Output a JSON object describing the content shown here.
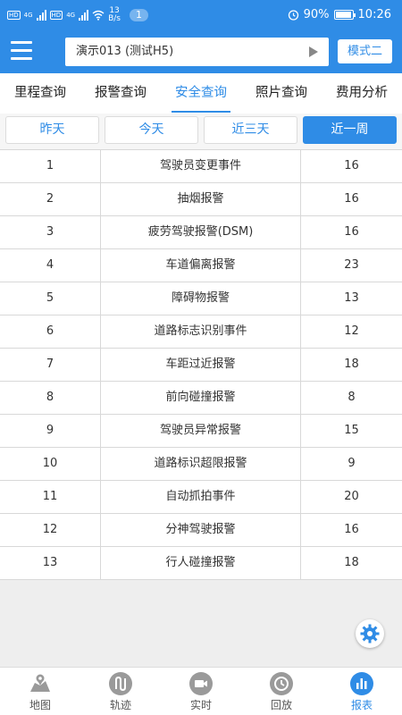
{
  "status_bar": {
    "net_speed": "13",
    "net_unit": "B/s",
    "notification_count": "1",
    "battery": "90%",
    "time": "10:26",
    "signal1": "4G",
    "signal2": "4G"
  },
  "header": {
    "vehicle": "演示013 (测试H5)",
    "mode_button": "模式二"
  },
  "tabs": [
    {
      "label": "里程查询"
    },
    {
      "label": "报警查询"
    },
    {
      "label": "安全查询"
    },
    {
      "label": "照片查询"
    },
    {
      "label": "费用分析"
    }
  ],
  "filters": [
    {
      "label": "昨天"
    },
    {
      "label": "今天"
    },
    {
      "label": "近三天"
    },
    {
      "label": "近一周"
    }
  ],
  "rows": [
    {
      "no": "1",
      "name": "驾驶员变更事件",
      "count": "16"
    },
    {
      "no": "2",
      "name": "抽烟报警",
      "count": "16"
    },
    {
      "no": "3",
      "name": "疲劳驾驶报警(DSM)",
      "count": "16"
    },
    {
      "no": "4",
      "name": "车道偏离报警",
      "count": "23"
    },
    {
      "no": "5",
      "name": "障碍物报警",
      "count": "13"
    },
    {
      "no": "6",
      "name": "道路标志识别事件",
      "count": "12"
    },
    {
      "no": "7",
      "name": "车距过近报警",
      "count": "18"
    },
    {
      "no": "8",
      "name": "前向碰撞报警",
      "count": "8"
    },
    {
      "no": "9",
      "name": "驾驶员异常报警",
      "count": "15"
    },
    {
      "no": "10",
      "name": "道路标识超限报警",
      "count": "9"
    },
    {
      "no": "11",
      "name": "自动抓拍事件",
      "count": "20"
    },
    {
      "no": "12",
      "name": "分神驾驶报警",
      "count": "16"
    },
    {
      "no": "13",
      "name": "行人碰撞报警",
      "count": "18"
    }
  ],
  "bottom_nav": [
    {
      "label": "地图",
      "icon": "map-icon"
    },
    {
      "label": "轨迹",
      "icon": "track-icon"
    },
    {
      "label": "实时",
      "icon": "video-icon"
    },
    {
      "label": "回放",
      "icon": "replay-icon"
    },
    {
      "label": "报表",
      "icon": "report-icon"
    }
  ],
  "colors": {
    "primary": "#2f8ce6",
    "nav_inactive": "#9a9a9a"
  }
}
